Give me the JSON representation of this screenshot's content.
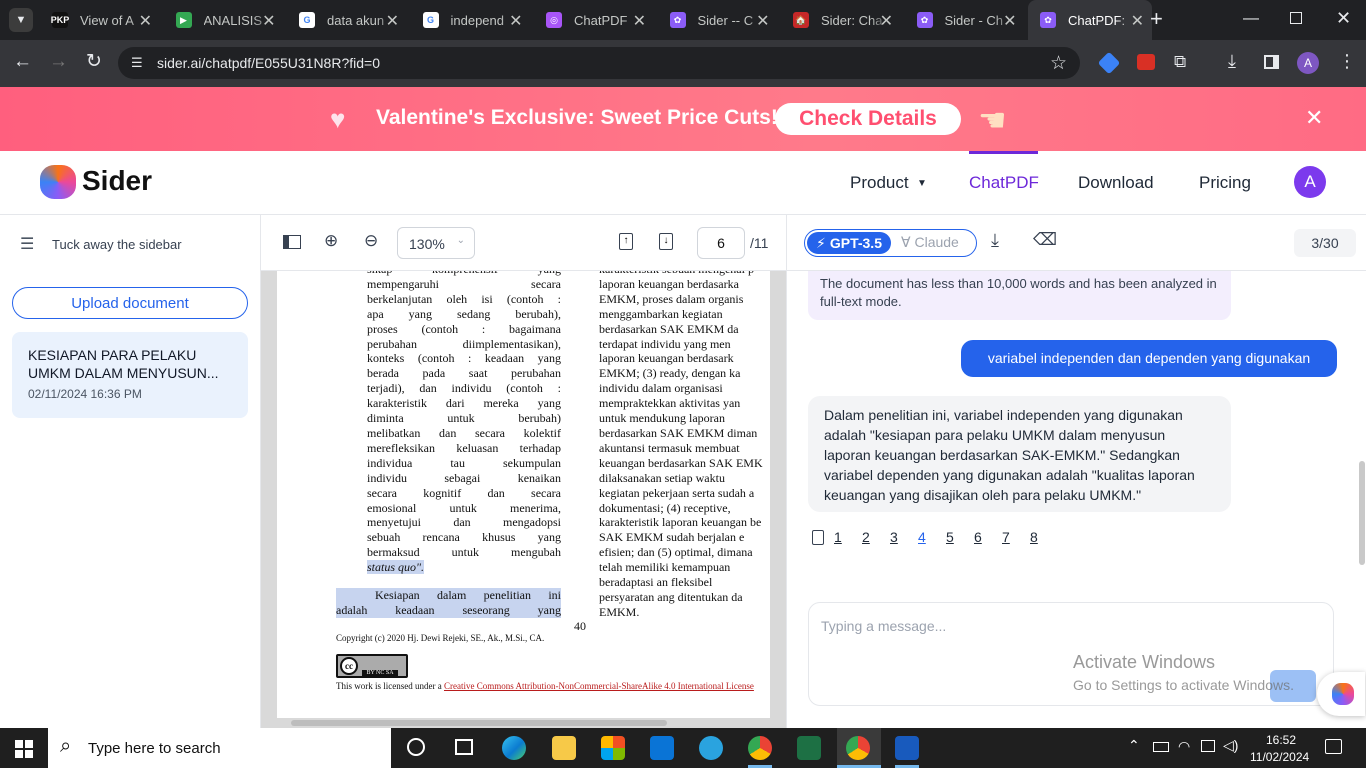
{
  "browser": {
    "tabs": [
      {
        "title": "View of A",
        "favicon": "PKP"
      },
      {
        "title": "ANALISIS",
        "favicon": "docs"
      },
      {
        "title": "data akun",
        "favicon": "G"
      },
      {
        "title": "independ",
        "favicon": "G"
      },
      {
        "title": "ChatPDF",
        "favicon": "chatpdf"
      },
      {
        "title": "Sider -- C",
        "favicon": "sider"
      },
      {
        "title": "Sider: Cha",
        "favicon": "store"
      },
      {
        "title": "Sider - Ch",
        "favicon": "sider"
      },
      {
        "title": "ChatPDF:",
        "favicon": "sider"
      }
    ],
    "url": "sider.ai/chatpdf/E055U31N8R?fid=0",
    "profile_initial": "A"
  },
  "promo": {
    "text": "Valentine's Exclusive: Sweet Price Cuts!",
    "cta": "Check Details"
  },
  "header": {
    "brand": "Sider",
    "nav": {
      "product": "Product",
      "chatpdf": "ChatPDF",
      "download": "Download",
      "pricing": "Pricing"
    },
    "avatar": "A"
  },
  "sidebar": {
    "tuck": "Tuck away the sidebar",
    "upload": "Upload document",
    "doc": {
      "title": "KESIAPAN PARA PELAKU UMKM DALAM MENYUSUN...",
      "date": "02/11/2024 16:36 PM"
    }
  },
  "pdf": {
    "zoom": "130%",
    "page": "6",
    "total": "/11",
    "left_col": [
      "sikap komprehensif yang",
      "mempengaruhi secara",
      "berkelanjutan oleh isi (contoh :",
      "apa yang sedang berubah),",
      "proses (contoh : bagaimana",
      "perubahan diimplementasikan),",
      "konteks (contoh : keadaan yang",
      "berada pada saat perubahan",
      "terjadi), dan individu (contoh :",
      "karakteristik dari mereka yang",
      "diminta untuk berubah)",
      "melibatkan dan secara kolektif",
      "merefleksikan keluasan terhadap",
      "individua tau sekumpulan",
      "individu sebagai kenaikan",
      "secara kognitif dan secara",
      "emosional untuk menerima,",
      "menyetujui dan mengadopsi",
      "sebuah rencana khusus yang",
      "bermaksud untuk mengubah"
    ],
    "left_quote": "status quo\".",
    "left_para": [
      "Kesiapan dalam penelitian ini",
      "adalah keadaan seseorang yang"
    ],
    "right_col": [
      "karakteristik sebuah mengenai p",
      "laporan keuangan berdasarka",
      "EMKM, proses dalam organis",
      "menggambarkan kegiatan",
      "berdasarkan SAK EMKM da",
      "terdapat individu yang men",
      "laporan keuangan berdasark",
      "EMKM; (3) ready, dengan ka",
      "individu dalam organisasi",
      "mempraktekkan aktivitas yan",
      "untuk mendukung laporan",
      "berdasarkan SAK EMKM diman",
      "akuntansi termasuk membuat",
      "keuangan berdasarkan SAK EMK",
      "dilaksanakan setiap waktu",
      "kegiatan pekerjaan serta sudah a",
      "dokumentasi; (4) receptive,",
      "karakteristik laporan keuangan be",
      "SAK EMKM sudah berjalan e",
      "efisien; dan (5) optimal, dimana",
      "telah memiliki kemampuan",
      "beradaptasi an fleksibel",
      "persyaratan ang ditentukan da",
      "EMKM."
    ],
    "page_number": "40",
    "copyright": "Copyright (c) 2020 Hj. Dewi Rejeki, SE., Ak., M.Si., CA.",
    "license_prefix": "This work is licensed under a ",
    "license_link": "Creative Commons Attribution-NonCommercial-ShareAlike 4.0 International License",
    "cc_badge": "BY NC SA"
  },
  "chat": {
    "model_active": "GPT-3.5",
    "model_other": "Claude",
    "counter": "3/30",
    "notice": "The document has less than 10,000 words and has been analyzed in full-text mode.",
    "user_msg": "variabel independen dan dependen yang digunakan",
    "bot_msg": "Dalam penelitian ini, variabel independen yang digunakan adalah \"kesiapan para pelaku UMKM dalam menyusun laporan keuangan berdasarkan SAK-EMKM.\" Sedangkan variabel dependen yang digunakan adalah \"kualitas laporan keuangan yang disajikan oleh para pelaku UMKM.\"",
    "pages": [
      "1",
      "2",
      "3",
      "4",
      "5",
      "6",
      "7",
      "8"
    ],
    "active_page": "4",
    "placeholder": "Typing a message..."
  },
  "watermark": {
    "line1": "Activate Windows",
    "line2": "Go to Settings to activate Windows."
  },
  "taskbar": {
    "search_placeholder": "Type here to search",
    "time": "16:52",
    "date": "11/02/2024"
  },
  "colors": {
    "accent": "#2563eb",
    "brand_purple": "#6d28d9",
    "promo": "#ff6b84"
  }
}
